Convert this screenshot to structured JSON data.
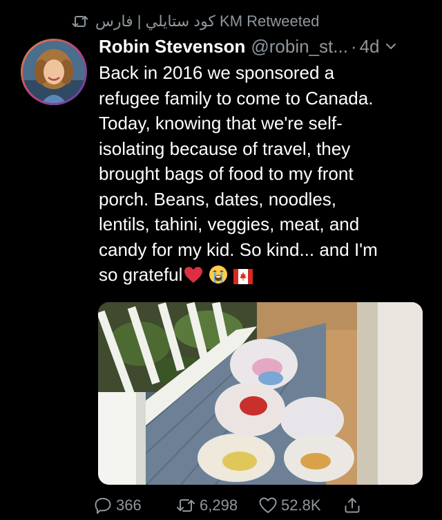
{
  "retweet_context": {
    "label": "كود ستايلي | فارس KM Retweeted",
    "icon": "retweet-icon"
  },
  "author": {
    "display_name": "Robin Stevenson",
    "handle": "@robin_st...",
    "separator": "·",
    "time": "4d"
  },
  "tweet": {
    "lines": [
      "Back in 2016 we sponsored a",
      "refugee family to come to Canada.",
      "Today, knowing that we're self-",
      "isolating because of travel, they",
      "brought bags of food to my front",
      "porch. Beans, dates, noodles,",
      "lentils, tahini, veggies, meat, and",
      "candy for my kid. So kind... and I'm",
      "so grateful"
    ],
    "emojis": [
      "red-heart",
      "loudly-crying-face",
      "canada-flag"
    ]
  },
  "actions": {
    "reply_count": "366",
    "retweet_count": "6,298",
    "like_count": "52.8K"
  },
  "colors": {
    "background": "#000000",
    "text": "#ffffff",
    "muted": "#8f979e"
  }
}
